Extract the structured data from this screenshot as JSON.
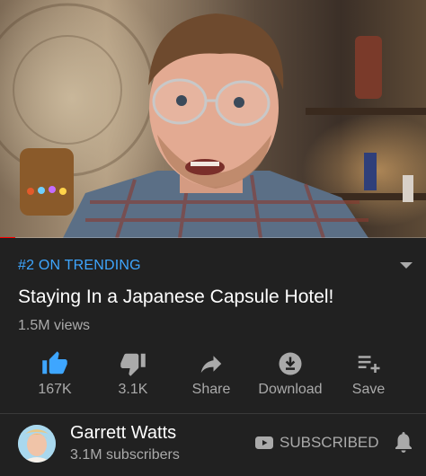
{
  "video": {
    "progress_fraction": 0.035
  },
  "info": {
    "trending": "#2 ON TRENDING",
    "title": "Staying In a Japanese Capsule Hotel!",
    "views": "1.5M views"
  },
  "actions": [
    {
      "label": "167K",
      "icon": "thumbs-up-icon",
      "active": true
    },
    {
      "label": "3.1K",
      "icon": "thumbs-down-icon",
      "active": false
    },
    {
      "label": "Share",
      "icon": "share-icon",
      "active": false
    },
    {
      "label": "Download",
      "icon": "download-icon",
      "active": false
    },
    {
      "label": "Save",
      "icon": "save-playlist-icon",
      "active": false
    }
  ],
  "channel": {
    "name": "Garrett Watts",
    "subscribers": "3.1M subscribers",
    "subscribe_state": "SUBSCRIBED"
  },
  "colors": {
    "background": "#212121",
    "accent_blue": "#3ea6ff",
    "secondary_text": "#aaaaaa",
    "progress_red": "#ff0000"
  }
}
